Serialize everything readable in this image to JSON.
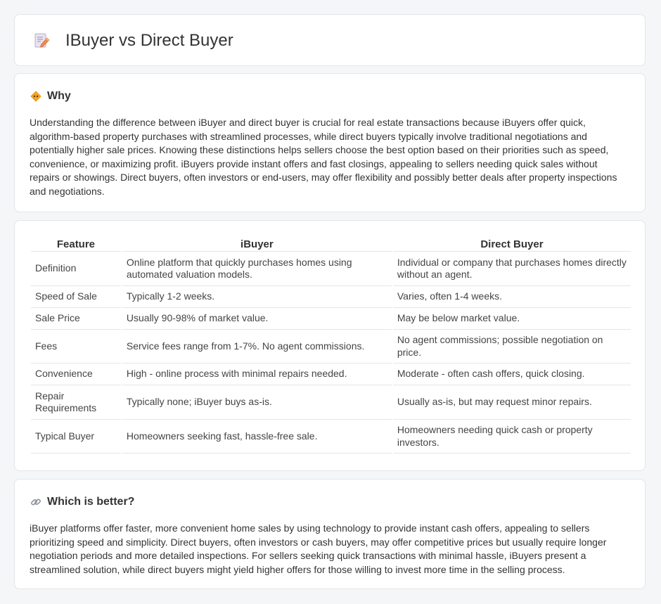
{
  "header": {
    "title": "IBuyer vs Direct Buyer",
    "icon": "document-pencil-icon"
  },
  "why": {
    "title": "Why",
    "icon": "diamond-warning-icon",
    "text": "Understanding the difference between iBuyer and direct buyer is crucial for real estate transactions because iBuyers offer quick, algorithm-based property purchases with streamlined processes, while direct buyers typically involve traditional negotiations and potentially higher sale prices. Knowing these distinctions helps sellers choose the best option based on their priorities such as speed, convenience, or maximizing profit. iBuyers provide instant offers and fast closings, appealing to sellers needing quick sales without repairs or showings. Direct buyers, often investors or end-users, may offer flexibility and possibly better deals after property inspections and negotiations."
  },
  "table": {
    "headers": [
      "Feature",
      "iBuyer",
      "Direct Buyer"
    ],
    "rows": [
      [
        "Definition",
        "Online platform that quickly purchases homes using automated valuation models.",
        "Individual or company that purchases homes directly without an agent."
      ],
      [
        "Speed of Sale",
        "Typically 1-2 weeks.",
        "Varies, often 1-4 weeks."
      ],
      [
        "Sale Price",
        "Usually 90-98% of market value.",
        "May be below market value."
      ],
      [
        "Fees",
        "Service fees range from 1-7%. No agent commissions.",
        "No agent commissions; possible negotiation on price."
      ],
      [
        "Convenience",
        "High - online process with minimal repairs needed.",
        "Moderate - often cash offers, quick closing."
      ],
      [
        "Repair Requirements",
        "Typically none; iBuyer buys as-is.",
        "Usually as-is, but may request minor repairs."
      ],
      [
        "Typical Buyer",
        "Homeowners seeking fast, hassle-free sale.",
        "Homeowners needing quick cash or property investors."
      ]
    ]
  },
  "better": {
    "title": "Which is better?",
    "icon": "link-icon",
    "text": "iBuyer platforms offer faster, more convenient home sales by using technology to provide instant cash offers, appealing to sellers prioritizing speed and simplicity. Direct buyers, often investors or cash buyers, may offer competitive prices but usually require longer negotiation periods and more detailed inspections. For sellers seeking quick transactions with minimal hassle, iBuyers present a streamlined solution, while direct buyers might yield higher offers for those willing to invest more time in the selling process."
  }
}
